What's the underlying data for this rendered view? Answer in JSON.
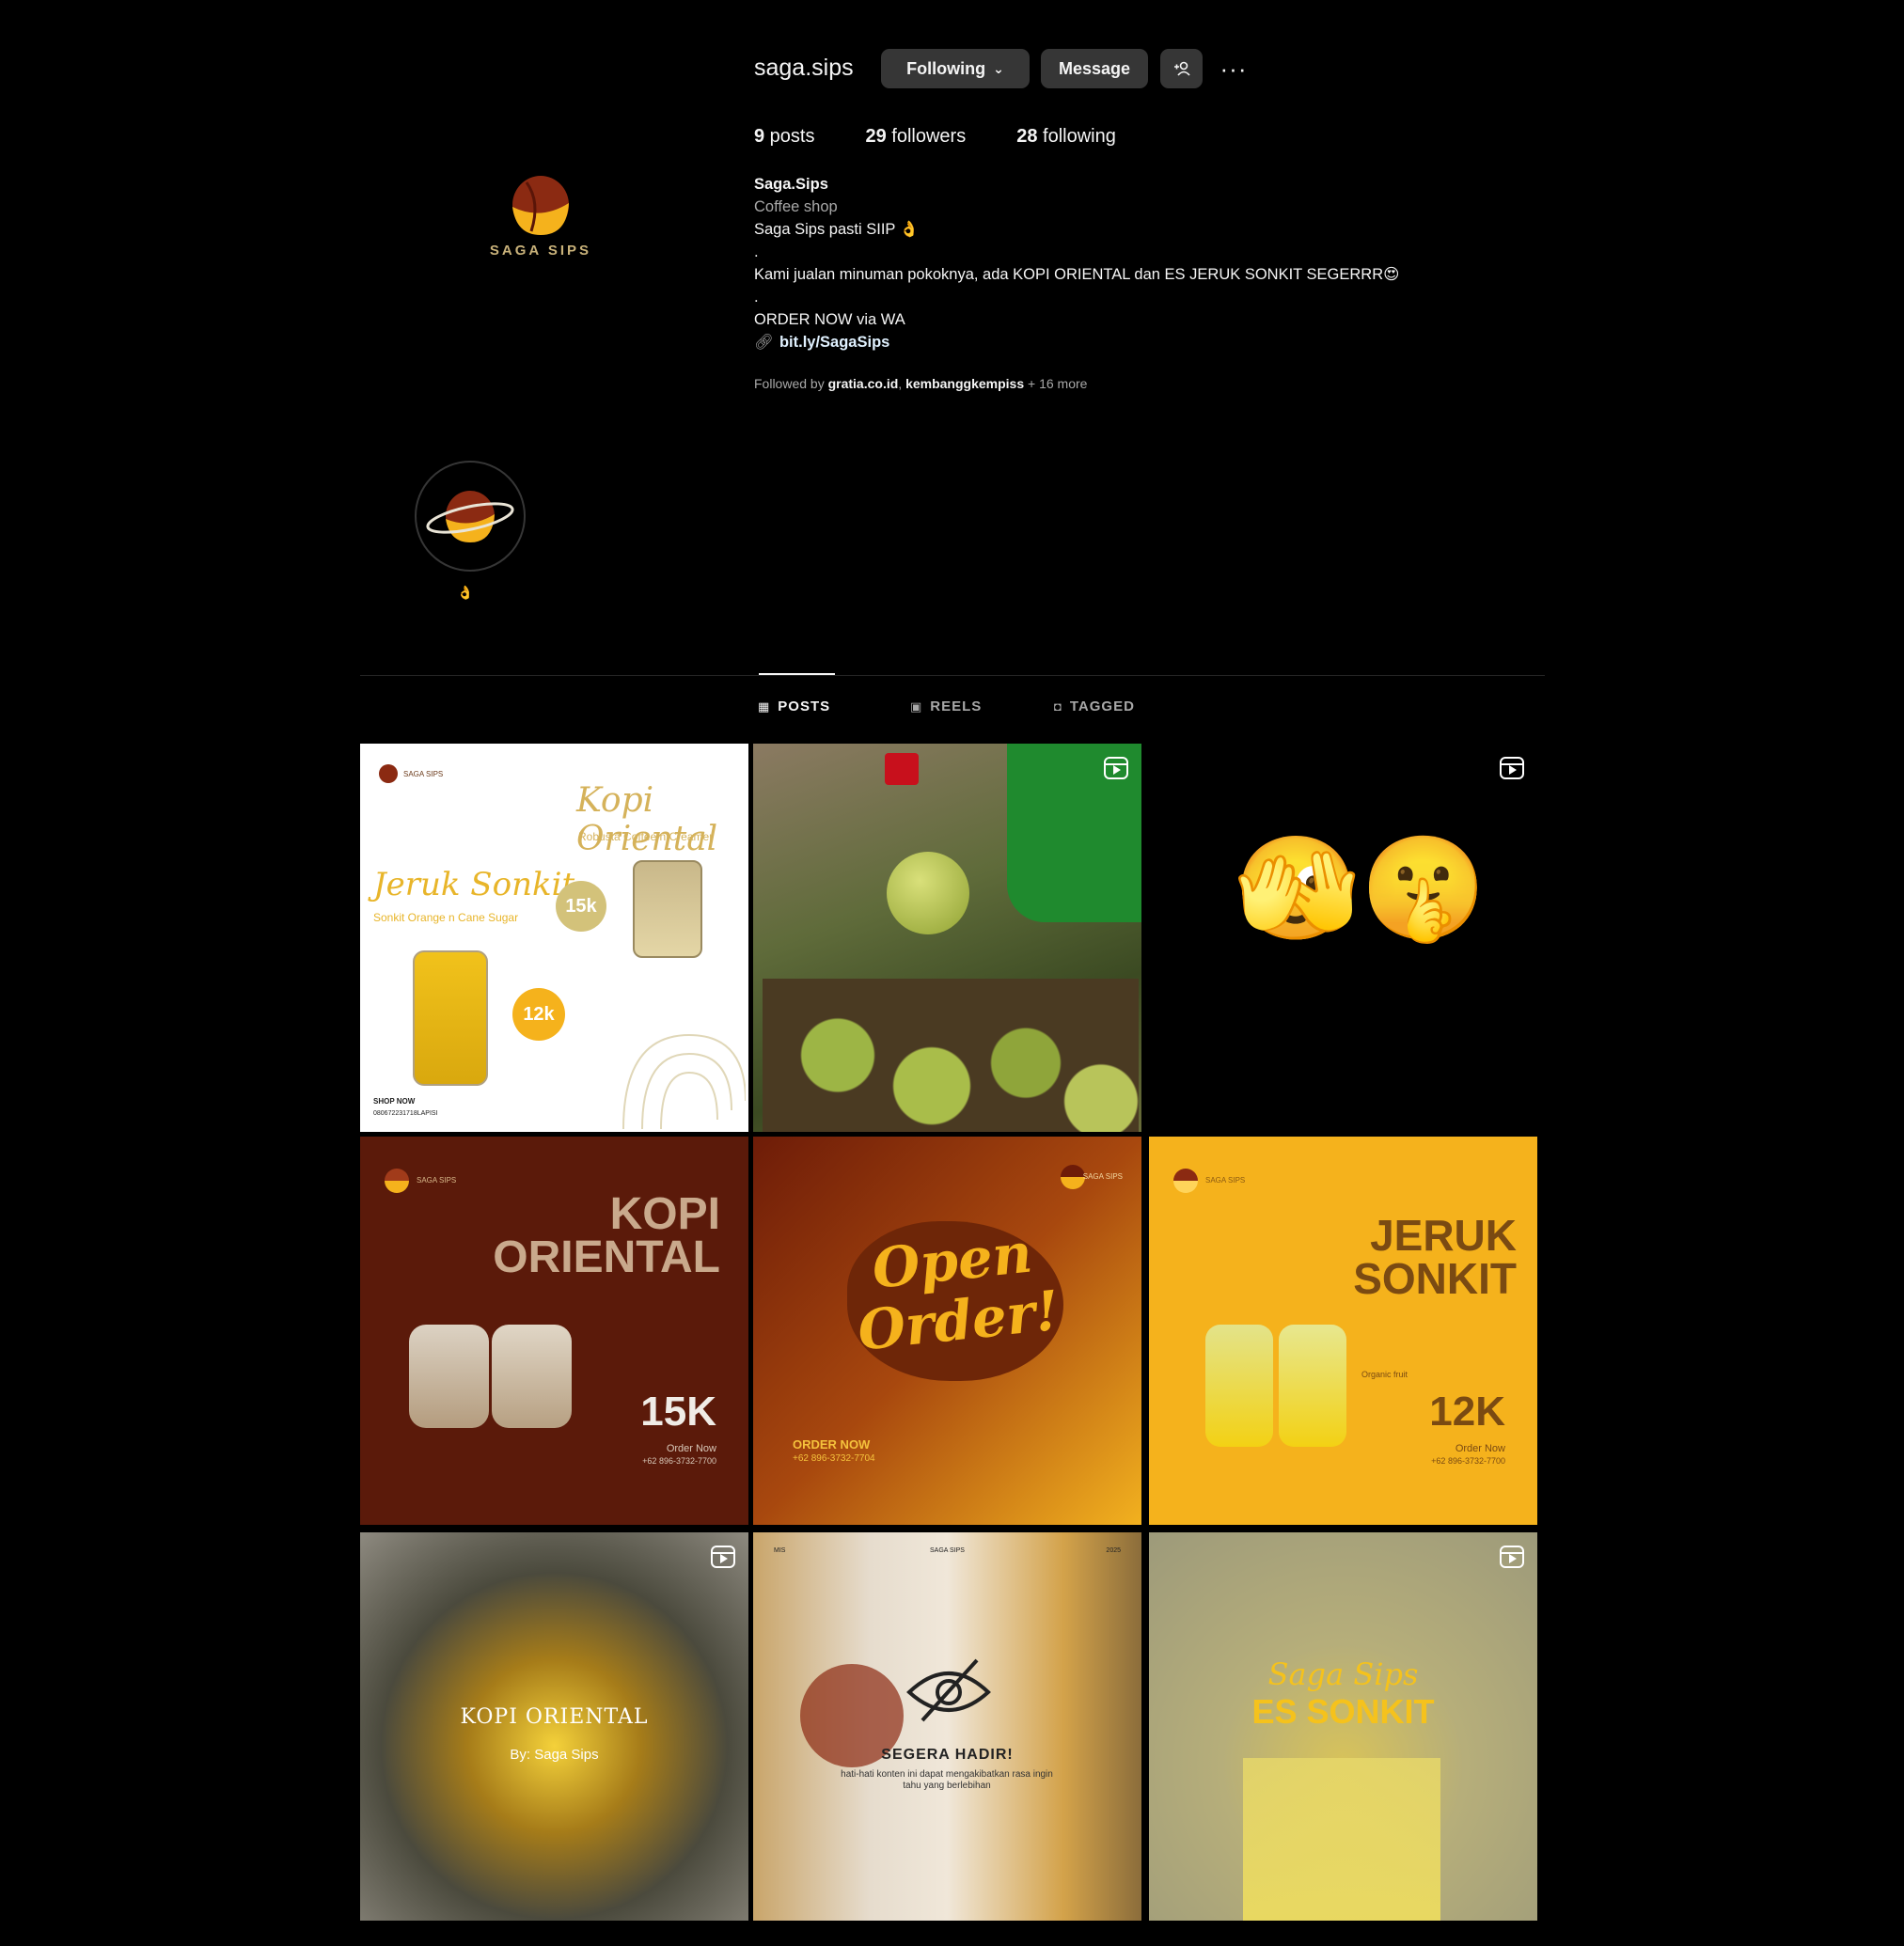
{
  "profile": {
    "username": "saga.sips",
    "logo_text": "SAGA SIPS",
    "buttons": {
      "following": "Following",
      "message": "Message"
    },
    "stats": {
      "posts": "9",
      "posts_label": " posts",
      "followers": "29",
      "followers_label": " followers",
      "following": "28",
      "following_label": " following"
    },
    "bio": {
      "name": "Saga.Sips",
      "category": "Coffee shop",
      "line1": "Saga Sips pasti SIIP 👌",
      "dot1": ".",
      "line2": "Kami jualan minuman pokoknya, ada KOPI ORIENTAL dan ES JERUK SONKIT SEGERRR😍",
      "dot2": ".",
      "line3": "ORDER NOW via WA",
      "link": "bit.ly/SagaSips"
    },
    "followed_by": {
      "prefix": "Followed by ",
      "user1": "gratia.co.id",
      "sep": ", ",
      "user2": "kembanggkempiss",
      "suffix": " + 16 more"
    }
  },
  "highlight": {
    "label": "👌"
  },
  "tabs": [
    {
      "label": "POSTS",
      "icon": "grid-icon",
      "active": true
    },
    {
      "label": "REELS",
      "icon": "reels-icon",
      "active": false
    },
    {
      "label": "TAGGED",
      "icon": "tagged-icon",
      "active": false
    }
  ],
  "posts": {
    "p1": {
      "brand": "SAGA SIPS",
      "title1": "Kopi Oriental",
      "sub1": "Robusta Coffee n Creamer",
      "title2": "Jeruk Sonkit",
      "sub2": "Sonkit Orange n Cane Sugar",
      "price1": "15k",
      "price2": "12k",
      "shop": "SHOP NOW",
      "shop_link": "080672231718LAPISI"
    },
    "p2": {},
    "p3": {
      "emoji": "🫣🤫"
    },
    "p4": {
      "brand": "SAGA SIPS",
      "title": "KOPI\nORIENTAL",
      "price": "15K",
      "order": "Order Now",
      "phone": "+62 896-3732-7700"
    },
    "p5": {
      "brand": "SAGA SIPS",
      "title": "Open\nOrder!",
      "order": "ORDER NOW",
      "phone": "+62 896-3732-7704"
    },
    "p6": {
      "brand": "SAGA SIPS",
      "title": "JERUK\nSONKIT",
      "note": "Organic fruit",
      "price": "12K",
      "order": "Order Now",
      "phone": "+62 896-3732-7700"
    },
    "p7": {
      "title": "KOPI ORIENTAL",
      "by": "By: Saga Sips"
    },
    "p8": {
      "top_left": "MIS",
      "top_center": "SAGA SIPS",
      "top_right": "2025",
      "title": "SEGERA HADIR!",
      "desc": "hati-hati konten ini dapat mengakibatkan rasa ingin tahu yang berlebihan"
    },
    "p9": {
      "script": "Saga Sips",
      "title": "ES SONKIT"
    }
  },
  "colors": {
    "background": "#000000",
    "button": "#363636",
    "muted": "#a8a8a8",
    "brand_brown": "#8b2a12",
    "brand_yellow": "#f5b21c"
  }
}
